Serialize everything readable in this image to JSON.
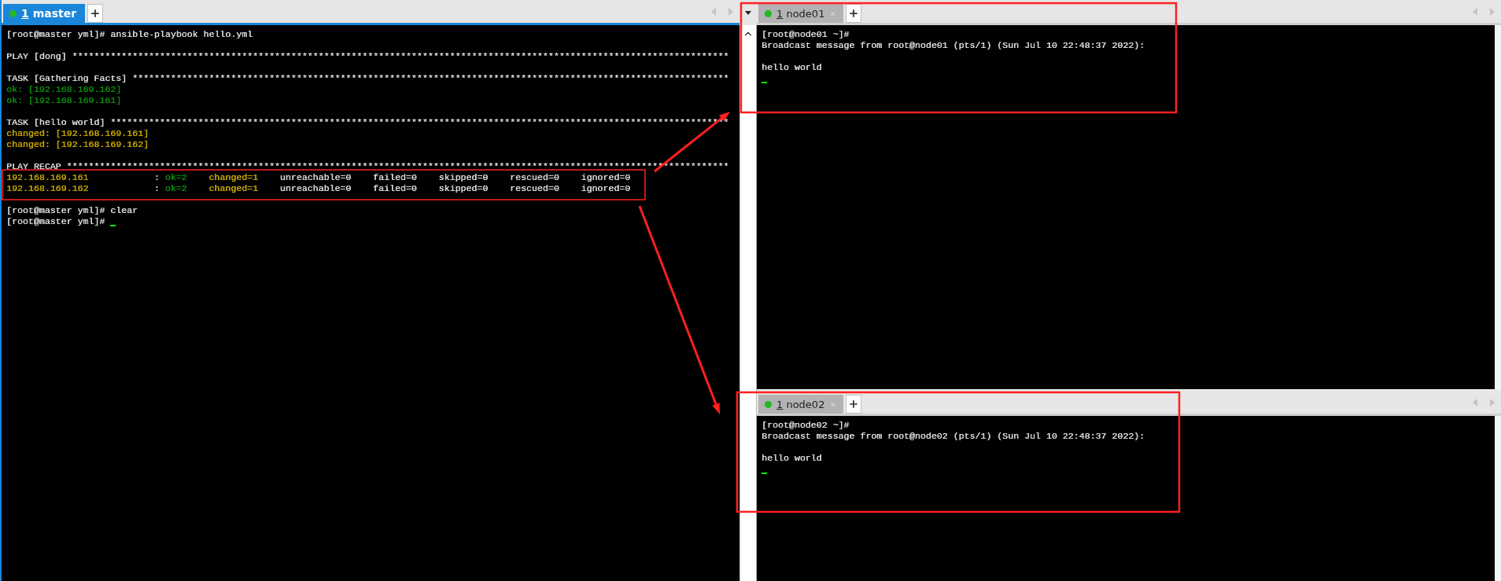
{
  "panes": [
    {
      "tab": {
        "number": "1",
        "name": "master",
        "selected": true
      },
      "lines": [
        {
          "kind": "text",
          "segments": [
            {
              "text": "[root@master yml]# ansible-playbook hello.yml",
              "color": "#d9d9d9"
            }
          ]
        },
        {
          "kind": "blank"
        },
        {
          "kind": "text",
          "segments": [
            {
              "text": "PLAY [dong] ************************************************************************************************************************",
              "color": "#d9d9d9"
            }
          ]
        },
        {
          "kind": "blank"
        },
        {
          "kind": "text",
          "segments": [
            {
              "text": "TASK [Gathering Facts] *************************************************************************************************************",
              "color": "#d9d9d9"
            }
          ]
        },
        {
          "kind": "text",
          "segments": [
            {
              "text": "ok: [192.168.169.162]",
              "color": "#0e8a0e"
            }
          ]
        },
        {
          "kind": "text",
          "segments": [
            {
              "text": "ok: [192.168.169.161]",
              "color": "#0e8a0e"
            }
          ]
        },
        {
          "kind": "blank"
        },
        {
          "kind": "text",
          "segments": [
            {
              "text": "TASK [hello world] *****************************************************************************************************************",
              "color": "#d9d9d9"
            }
          ]
        },
        {
          "kind": "text",
          "segments": [
            {
              "text": "changed: [192.168.169.161]",
              "color": "#c4a500"
            }
          ]
        },
        {
          "kind": "text",
          "segments": [
            {
              "text": "changed: [192.168.169.162]",
              "color": "#c4a500"
            }
          ]
        },
        {
          "kind": "blank"
        },
        {
          "kind": "text",
          "segments": [
            {
              "text": "PLAY RECAP *************************************************************************************************************************",
              "color": "#d9d9d9"
            }
          ]
        },
        {
          "kind": "recap",
          "segments": [
            {
              "text": "192.168.169.161",
              "color": "#c4a500"
            },
            {
              "text": ":"
            },
            {
              "text": "ok=2",
              "color": "#0e8a0e"
            },
            {
              "text": "changed=1",
              "color": "#c4a500"
            },
            {
              "text": "unreachable=0",
              "color": "#d9d9d9"
            },
            {
              "text": "failed=0",
              "color": "#d9d9d9"
            },
            {
              "text": "skipped=0",
              "color": "#d9d9d9"
            },
            {
              "text": "rescued=0",
              "color": "#d9d9d9"
            },
            {
              "text": "ignored=0",
              "color": "#d9d9d9"
            }
          ]
        },
        {
          "kind": "recap",
          "segments": [
            {
              "text": "192.168.169.162",
              "color": "#c4a500"
            },
            {
              "text": ":"
            },
            {
              "text": "ok=2",
              "color": "#0e8a0e"
            },
            {
              "text": "changed=1",
              "color": "#c4a500"
            },
            {
              "text": "unreachable=0",
              "color": "#d9d9d9"
            },
            {
              "text": "failed=0",
              "color": "#d9d9d9"
            },
            {
              "text": "skipped=0",
              "color": "#d9d9d9"
            },
            {
              "text": "rescued=0",
              "color": "#d9d9d9"
            },
            {
              "text": "ignored=0",
              "color": "#d9d9d9"
            }
          ]
        },
        {
          "kind": "blank"
        },
        {
          "kind": "text",
          "segments": [
            {
              "text": "[root@master yml]# clear",
              "color": "#d9d9d9"
            }
          ]
        },
        {
          "kind": "text",
          "cursor": true,
          "segments": [
            {
              "text": "[root@master yml]#",
              "color": "#d9d9d9"
            }
          ]
        }
      ]
    },
    {
      "tab": {
        "number": "1",
        "name": "node01",
        "selected": false
      },
      "lines": [
        {
          "kind": "text",
          "segments": [
            {
              "text": "[root@node01 ~]#",
              "color": "#d9d9d9"
            }
          ]
        },
        {
          "kind": "text",
          "segments": [
            {
              "text": "Broadcast message from root@node01 (pts/1) (Sun Jul 10 22:48:37 2022):",
              "color": "#d9d9d9"
            }
          ]
        },
        {
          "kind": "blank"
        },
        {
          "kind": "text",
          "segments": [
            {
              "text": "hello world",
              "color": "#d9d9d9"
            }
          ]
        },
        {
          "kind": "cursor"
        }
      ]
    },
    {
      "tab": {
        "number": "1",
        "name": "node02",
        "selected": false
      },
      "lines": [
        {
          "kind": "text",
          "segments": [
            {
              "text": "[root@node02 ~]#",
              "color": "#d9d9d9"
            }
          ]
        },
        {
          "kind": "text",
          "segments": [
            {
              "text": "Broadcast message from root@node02 (pts/1) (Sun Jul 10 22:48:37 2022):",
              "color": "#d9d9d9"
            }
          ]
        },
        {
          "kind": "blank"
        },
        {
          "kind": "text",
          "segments": [
            {
              "text": "hello world",
              "color": "#d9d9d9"
            }
          ]
        },
        {
          "kind": "cursor"
        }
      ]
    }
  ]
}
